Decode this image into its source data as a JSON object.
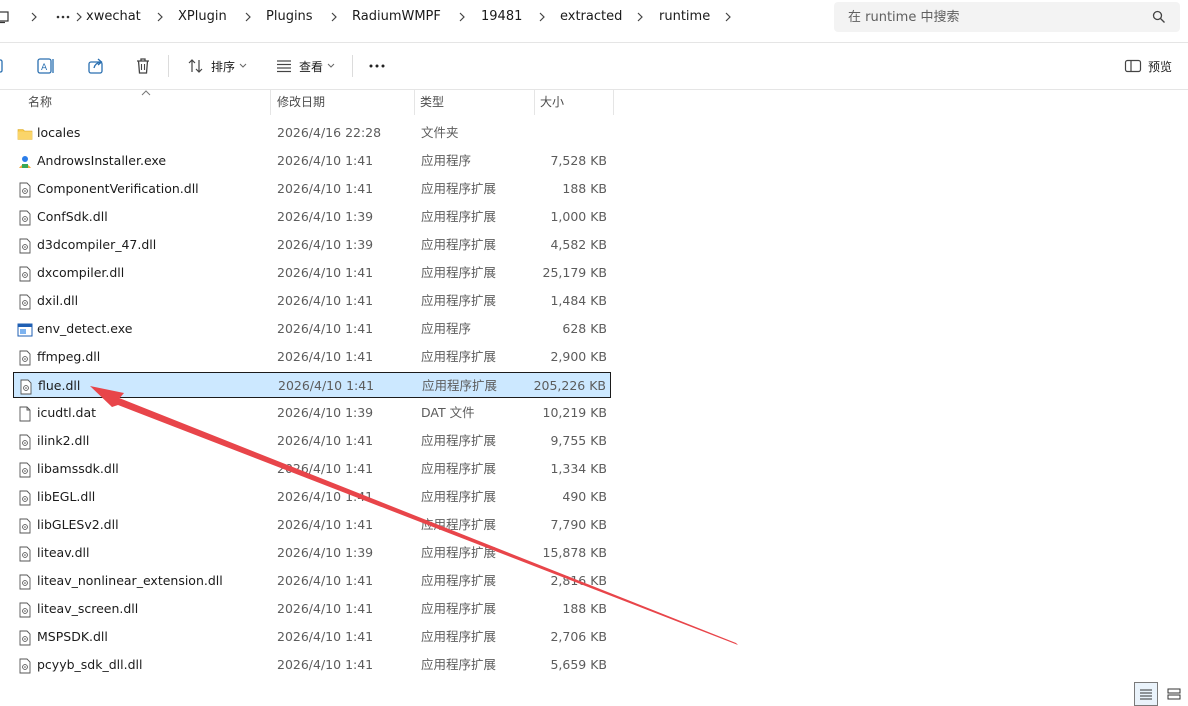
{
  "breadcrumb": {
    "items": [
      "xwechat",
      "XPlugin",
      "Plugins",
      "RadiumWMPF",
      "19481",
      "extracted",
      "runtime"
    ]
  },
  "search": {
    "placeholder": "在 runtime 中搜索"
  },
  "toolbar": {
    "sort_label": "排序",
    "view_label": "查看",
    "preview_label": "预览"
  },
  "columns": {
    "name": "名称",
    "date": "修改日期",
    "type": "类型",
    "size": "大小"
  },
  "files": [
    {
      "name": "locales",
      "date": "2026/4/16 22:28",
      "type": "文件夹",
      "size": "",
      "icon": "folder-icon"
    },
    {
      "name": "AndrowsInstaller.exe",
      "date": "2026/4/10 1:41",
      "type": "应用程序",
      "size": "7,528 KB",
      "icon": "installer-icon"
    },
    {
      "name": "ComponentVerification.dll",
      "date": "2026/4/10 1:41",
      "type": "应用程序扩展",
      "size": "188 KB",
      "icon": "dll-file-icon"
    },
    {
      "name": "ConfSdk.dll",
      "date": "2026/4/10 1:39",
      "type": "应用程序扩展",
      "size": "1,000 KB",
      "icon": "dll-file-icon"
    },
    {
      "name": "d3dcompiler_47.dll",
      "date": "2026/4/10 1:39",
      "type": "应用程序扩展",
      "size": "4,582 KB",
      "icon": "dll-file-icon"
    },
    {
      "name": "dxcompiler.dll",
      "date": "2026/4/10 1:41",
      "type": "应用程序扩展",
      "size": "25,179 KB",
      "icon": "dll-file-icon"
    },
    {
      "name": "dxil.dll",
      "date": "2026/4/10 1:41",
      "type": "应用程序扩展",
      "size": "1,484 KB",
      "icon": "dll-file-icon"
    },
    {
      "name": "env_detect.exe",
      "date": "2026/4/10 1:41",
      "type": "应用程序",
      "size": "628 KB",
      "icon": "exe-window-icon"
    },
    {
      "name": "ffmpeg.dll",
      "date": "2026/4/10 1:41",
      "type": "应用程序扩展",
      "size": "2,900 KB",
      "icon": "dll-file-icon"
    },
    {
      "name": "flue.dll",
      "date": "2026/4/10 1:41",
      "type": "应用程序扩展",
      "size": "205,226 KB",
      "icon": "dll-file-icon",
      "selected": true
    },
    {
      "name": "icudtl.dat",
      "date": "2026/4/10 1:39",
      "type": "DAT 文件",
      "size": "10,219 KB",
      "icon": "blank-file-icon"
    },
    {
      "name": "ilink2.dll",
      "date": "2026/4/10 1:41",
      "type": "应用程序扩展",
      "size": "9,755 KB",
      "icon": "dll-file-icon"
    },
    {
      "name": "libamssdk.dll",
      "date": "2026/4/10 1:41",
      "type": "应用程序扩展",
      "size": "1,334 KB",
      "icon": "dll-file-icon"
    },
    {
      "name": "libEGL.dll",
      "date": "2026/4/10 1:41",
      "type": "应用程序扩展",
      "size": "490 KB",
      "icon": "dll-file-icon"
    },
    {
      "name": "libGLESv2.dll",
      "date": "2026/4/10 1:41",
      "type": "应用程序扩展",
      "size": "7,790 KB",
      "icon": "dll-file-icon"
    },
    {
      "name": "liteav.dll",
      "date": "2026/4/10 1:39",
      "type": "应用程序扩展",
      "size": "15,878 KB",
      "icon": "dll-file-icon"
    },
    {
      "name": "liteav_nonlinear_extension.dll",
      "date": "2026/4/10 1:41",
      "type": "应用程序扩展",
      "size": "2,816 KB",
      "icon": "dll-file-icon"
    },
    {
      "name": "liteav_screen.dll",
      "date": "2026/4/10 1:41",
      "type": "应用程序扩展",
      "size": "188 KB",
      "icon": "dll-file-icon"
    },
    {
      "name": "MSPSDK.dll",
      "date": "2026/4/10 1:41",
      "type": "应用程序扩展",
      "size": "2,706 KB",
      "icon": "dll-file-icon"
    },
    {
      "name": "pcyyb_sdk_dll.dll",
      "date": "2026/4/10 1:41",
      "type": "应用程序扩展",
      "size": "5,659 KB",
      "icon": "dll-file-icon"
    }
  ],
  "annotation": {
    "color": "#e8454a"
  },
  "colors": {
    "selection": "#cce8ff",
    "folder": "#f8c948"
  }
}
